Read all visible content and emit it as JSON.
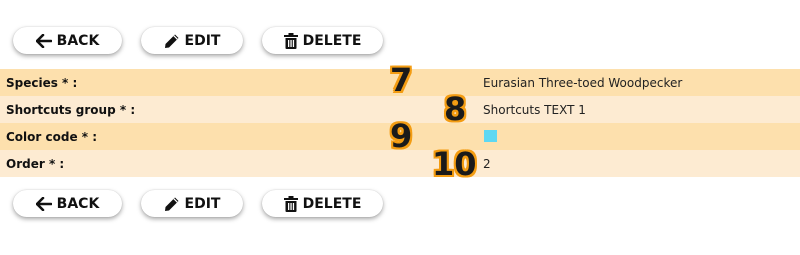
{
  "toolbar": {
    "back_label": "BACK",
    "edit_label": "EDIT",
    "delete_label": "DELETE"
  },
  "fields": [
    {
      "label": "Species * :",
      "value": "Eurasian Three-toed Woodpecker"
    },
    {
      "label": "Shortcuts group * :",
      "value": "Shortcuts TEXT 1"
    },
    {
      "label": "Color code * :",
      "color": "#5ed8f2"
    },
    {
      "label": "Order * :",
      "value": "2"
    }
  ],
  "markers": [
    "7",
    "8",
    "9",
    "10"
  ],
  "colors": {
    "row_odd": "#fde0ad",
    "row_even": "#fdebd2",
    "marker_outline": "#f39c12"
  }
}
